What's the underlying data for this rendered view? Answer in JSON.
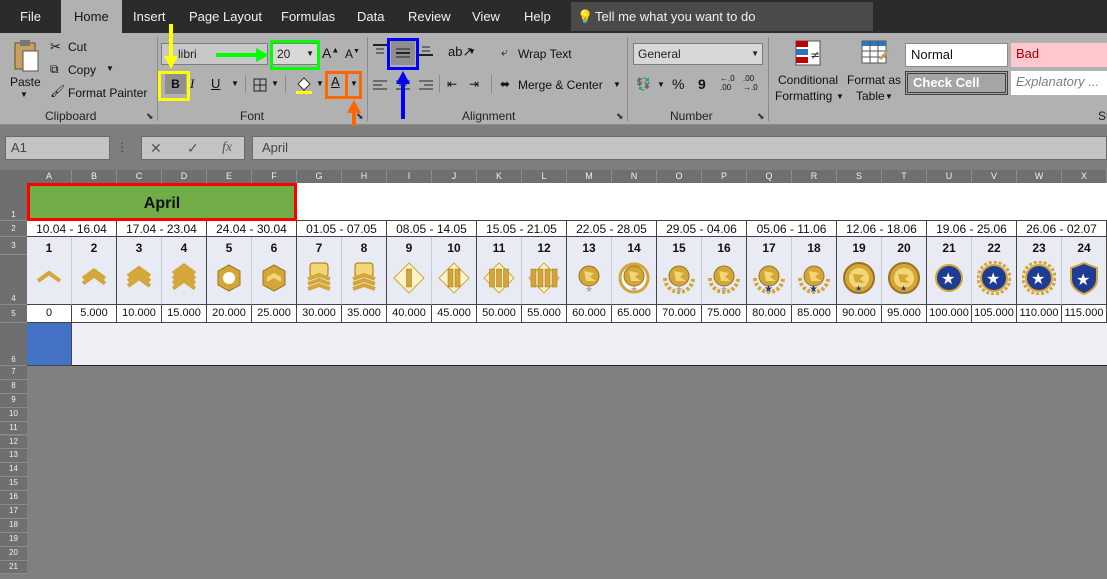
{
  "menu": {
    "tabs": [
      "File",
      "Home",
      "Insert",
      "Page Layout",
      "Formulas",
      "Data",
      "Review",
      "View",
      "Help"
    ],
    "tell_me": "Tell me what you want to do"
  },
  "ribbon": {
    "clipboard": {
      "paste": "Paste",
      "cut": "Cut",
      "copy": "Copy",
      "format_painter": "Format Painter",
      "label": "Clipboard"
    },
    "font": {
      "name": "libri",
      "size": "20",
      "bold": "B",
      "italic": "I",
      "underline": "U",
      "font_color": "A",
      "grow": "A",
      "shrink": "A",
      "label": "Font"
    },
    "alignment": {
      "wrap_text": "Wrap Text",
      "merge_center": "Merge & Center",
      "label": "Alignment"
    },
    "number": {
      "format": "General",
      "percent": "%",
      "comma": "9",
      "inc_decimal": "←.0\n.00",
      "dec_decimal": ".00\n→.0",
      "label": "Number"
    },
    "styles": {
      "conditional_formatting_1": "Conditional",
      "conditional_formatting_2": "Formatting",
      "format_as_table_1": "Format as",
      "format_as_table_2": "Table",
      "normal": "Normal",
      "bad": "Bad",
      "check_cell": "Check Cell",
      "explanatory": "Explanatory ...",
      "label": "St"
    }
  },
  "formula_bar": {
    "name_box": "A1",
    "cancel": "✕",
    "enter": "✓",
    "fx": "fx",
    "content": "April"
  },
  "colors": {
    "header_green": "#70ad47",
    "level_bg": "#e9ebf4",
    "selected_blue": "#4472c4",
    "annotation_red": "#ff0000",
    "annotation_yellow": "#ffff00",
    "annotation_green": "#00ff00",
    "annotation_blue": "#0000ff",
    "annotation_orange": "#ff6600"
  },
  "sheet": {
    "columns": [
      "A",
      "B",
      "C",
      "D",
      "E",
      "F",
      "G",
      "H",
      "I",
      "J",
      "K",
      "L",
      "M",
      "N",
      "O",
      "P",
      "Q",
      "R",
      "S",
      "T",
      "U",
      "V",
      "W",
      "X"
    ],
    "rows": [
      "1",
      "2",
      "3",
      "4",
      "5",
      "6",
      "7",
      "8",
      "9",
      "10",
      "11",
      "12",
      "13",
      "14",
      "15",
      "16",
      "17",
      "18",
      "19",
      "20",
      "21"
    ],
    "title": "April",
    "date_ranges": [
      "10.04 - 16.04",
      "17.04 - 23.04",
      "24.04 - 30.04",
      "01.05 - 07.05",
      "08.05 - 14.05",
      "15.05 - 21.05",
      "22.05 - 28.05",
      "29.05 - 04.06",
      "05.06 - 11.06",
      "12.06 - 18.06",
      "19.06 - 25.06",
      "26.06 - 02.07"
    ],
    "levels": [
      "1",
      "2",
      "3",
      "4",
      "5",
      "6",
      "7",
      "8",
      "9",
      "10",
      "11",
      "12",
      "13",
      "14",
      "15",
      "16",
      "17",
      "18",
      "19",
      "20",
      "21",
      "22",
      "23",
      "24"
    ],
    "level_icons": [
      "chevron-1-icon",
      "chevron-2-icon",
      "chevron-3-icon",
      "chevron-4-icon",
      "hexagon-badge-icon",
      "hexagon-chevron-icon",
      "gold-chevron-badge-icon",
      "gold-chevron-badge-icon",
      "gold-bar-1-icon",
      "gold-bar-2-icon",
      "gold-bar-3-icon",
      "gold-bar-4-icon",
      "eagle-icon",
      "eagle-medal-icon",
      "eagle-wreath-icon",
      "eagle-wreath-icon",
      "eagle-star-icon",
      "eagle-star-icon",
      "gold-medal-icon",
      "gold-medal-icon",
      "blue-star-medal-icon",
      "blue-star-medal-icon",
      "blue-star-medal-icon",
      "blue-shield-star-icon"
    ],
    "xp_values": [
      "0",
      "5.000",
      "10.000",
      "15.000",
      "20.000",
      "25.000",
      "30.000",
      "35.000",
      "40.000",
      "45.000",
      "50.000",
      "55.000",
      "60.000",
      "65.000",
      "70.000",
      "75.000",
      "80.000",
      "85.000",
      "90.000",
      "95.000",
      "100.000",
      "105.000",
      "110.000",
      "115.000"
    ]
  }
}
